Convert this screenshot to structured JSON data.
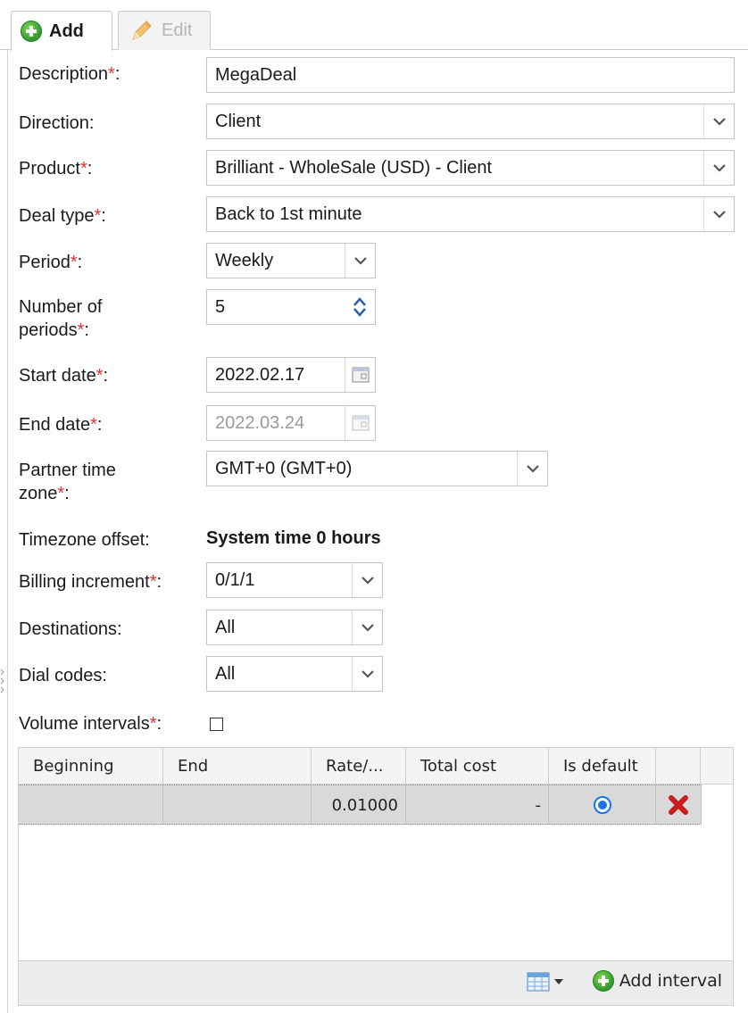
{
  "tabs": {
    "add_label": "Add",
    "edit_label": "Edit"
  },
  "form": {
    "description": {
      "label": "Description",
      "required": "*",
      "suffix": ":",
      "value": "MegaDeal"
    },
    "direction": {
      "label": "Direction:",
      "value": "Client"
    },
    "product": {
      "label": "Product",
      "required": "*",
      "suffix": ":",
      "value": "Brilliant - WholeSale (USD) - Client"
    },
    "deal_type": {
      "label": "Deal type",
      "required": "*",
      "suffix": ":",
      "value": "Back to 1st minute"
    },
    "period": {
      "label": "Period",
      "required": "*",
      "suffix": ":",
      "value": "Weekly"
    },
    "number_of_periods": {
      "label_line1": "Number of",
      "label_line2": "periods",
      "required": "*",
      "suffix": ":",
      "value": "5"
    },
    "start_date": {
      "label": "Start date",
      "required": "*",
      "suffix": ":",
      "value": "2022.02.17"
    },
    "end_date": {
      "label": "End date",
      "required": "*",
      "suffix": ":",
      "value": "2022.03.24"
    },
    "partner_time_zone": {
      "label_line1": "Partner time",
      "label_line2": "zone",
      "required": "*",
      "suffix": ":",
      "value": "GMT+0 (GMT+0)"
    },
    "timezone_offset": {
      "label": "Timezone offset:",
      "value": "System time 0 hours"
    },
    "billing_increment": {
      "label": "Billing increment",
      "required": "*",
      "suffix": ":",
      "value": "0/1/1"
    },
    "destinations": {
      "label": "Destinations:",
      "value": "All"
    },
    "dial_codes": {
      "label": "Dial codes:",
      "value": "All"
    },
    "volume_intervals": {
      "label": "Volume intervals",
      "required": "*",
      "suffix": ":",
      "checked": false
    }
  },
  "grid": {
    "columns": [
      "Beginning",
      "End",
      "Rate/...",
      "Total cost",
      "Is default"
    ],
    "rows": [
      {
        "beginning": "",
        "end": "",
        "rate": "0.01000",
        "total_cost": "-",
        "is_default": true
      }
    ],
    "footer": {
      "add_interval_label": "Add interval"
    }
  },
  "colors": {
    "required_star": "#e03030",
    "radio_accent": "#1a73e8",
    "delete_red": "#c81e1e",
    "add_green": "#2e9a2a"
  },
  "icons": [
    "plus-circle-icon",
    "pencil-icon",
    "chevron-down-icon",
    "spinner-up-down-icon",
    "calendar-icon",
    "radio-selected-icon",
    "delete-x-icon",
    "columns-grid-icon"
  ]
}
